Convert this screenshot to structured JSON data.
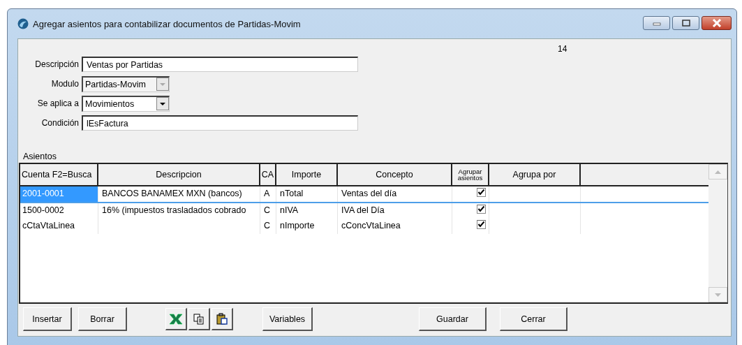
{
  "window": {
    "title": "Agregar asientos para contabilizar documentos de Partidas-Movim"
  },
  "record_number": "14",
  "fields": [
    {
      "label": "Descripción",
      "kind": "text",
      "value": "Ventas por Partidas",
      "disabled": false
    },
    {
      "label": "Modulo",
      "kind": "combo",
      "value": "Partidas-Movim",
      "disabled": true
    },
    {
      "label": "Se aplica a",
      "kind": "combo",
      "value": "Movimientos",
      "disabled": false
    },
    {
      "label": "Condición",
      "kind": "text",
      "value": "lEsFactura",
      "disabled": false
    }
  ],
  "grid": {
    "label": "Asientos",
    "columns": [
      "Cuenta F2=Busca",
      "Descripcion",
      "CA",
      "Importe",
      "Concepto",
      "Agrupar asientos",
      "Agrupa por"
    ],
    "rows": [
      {
        "cuenta": "2001-0001",
        "descripcion": "BANCOS BANAMEX MXN (bancos)",
        "ca": "A",
        "importe": "nTotal",
        "concepto": "Ventas del día",
        "agrupar": true,
        "selected": true
      },
      {
        "cuenta": "1500-0002",
        "descripcion": "16% (impuestos trasladados cobrado",
        "ca": "C",
        "importe": "nIVA",
        "concepto": "IVA del Día",
        "agrupar": true,
        "selected": false
      },
      {
        "cuenta": "cCtaVtaLinea",
        "descripcion": "",
        "ca": "C",
        "importe": "nImporte",
        "concepto": "cConcVtaLinea",
        "agrupar": true,
        "selected": false
      }
    ]
  },
  "buttons": [
    {
      "kind": "text",
      "label": "Insertar"
    },
    {
      "kind": "text",
      "label": "Borrar"
    },
    {
      "kind": "excel"
    },
    {
      "kind": "copy"
    },
    {
      "kind": "paste"
    },
    {
      "kind": "text",
      "label": "Variables"
    },
    {
      "kind": "text",
      "label": "Guardar"
    },
    {
      "kind": "text",
      "label": "Cerrar"
    }
  ]
}
